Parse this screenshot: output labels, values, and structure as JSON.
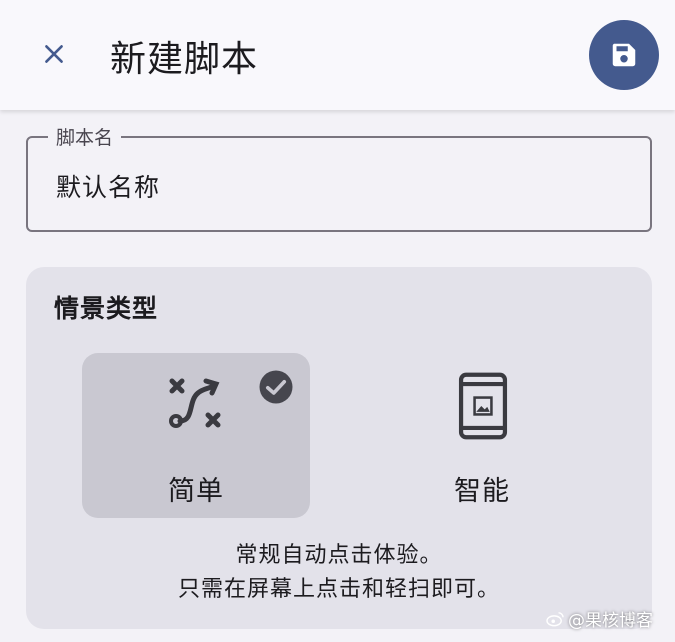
{
  "header": {
    "title": "新建脚本"
  },
  "name_field": {
    "label": "脚本名",
    "value": "默认名称"
  },
  "scene": {
    "title": "情景类型",
    "options": [
      {
        "label": "简单",
        "icon": "route-icon",
        "selected": true
      },
      {
        "label": "智能",
        "icon": "phone-image-icon",
        "selected": false
      }
    ],
    "description_line1": "常规自动点击体验。",
    "description_line2": "只需在屏幕上点击和轻扫即可。"
  },
  "watermark": {
    "text": "@果核博客"
  },
  "colors": {
    "accent": "#445a8e",
    "card": "#e3e2ea",
    "selected": "#c9c8d1"
  }
}
